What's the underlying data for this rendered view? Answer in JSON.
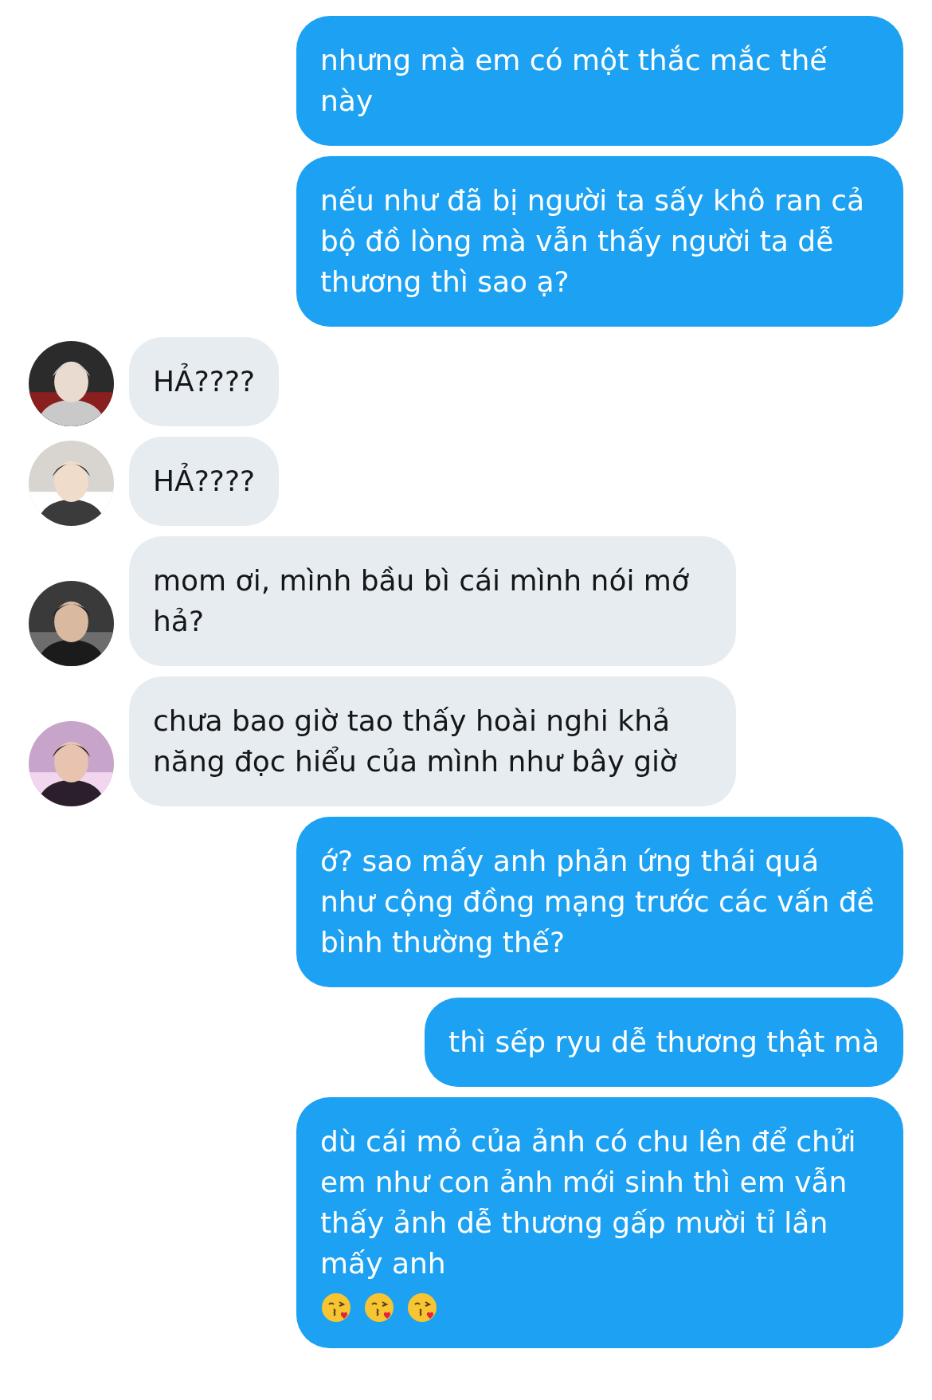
{
  "messages": [
    {
      "kind": "sent",
      "text": "nhưng mà em có một thắc mắc thế này"
    },
    {
      "kind": "sent",
      "text": "nếu như đã bị người ta sấy khô ran cả bộ đồ lòng mà vẫn thấy người ta dễ thương thì sao ạ?"
    },
    {
      "kind": "received",
      "text": "HẢ????"
    },
    {
      "kind": "received",
      "text": "HẢ????"
    },
    {
      "kind": "received",
      "text": "mom ơi, mình bầu bì cái mình nói mớ hả?"
    },
    {
      "kind": "received",
      "text": "chưa bao giờ tao thấy hoài nghi khả năng đọc hiểu của mình như bây giờ"
    },
    {
      "kind": "sent",
      "text": "ớ? sao mấy anh phản ứng thái quá như cộng đồng mạng trước các vấn đề bình thường thế?"
    },
    {
      "kind": "sent",
      "text": "thì sếp ryu dễ thương thật mà"
    },
    {
      "kind": "sent",
      "text": "dù cái mỏ của ảnh có chu lên để chửi em như con ảnh mới sinh thì em vẫn thấy ảnh dễ thương gấp mười tỉ lần mấy anh",
      "trailing_icons": [
        {
          "kind": "kiss-face"
        },
        {
          "kind": "kiss-face"
        },
        {
          "kind": "kiss-face"
        }
      ]
    }
  ]
}
